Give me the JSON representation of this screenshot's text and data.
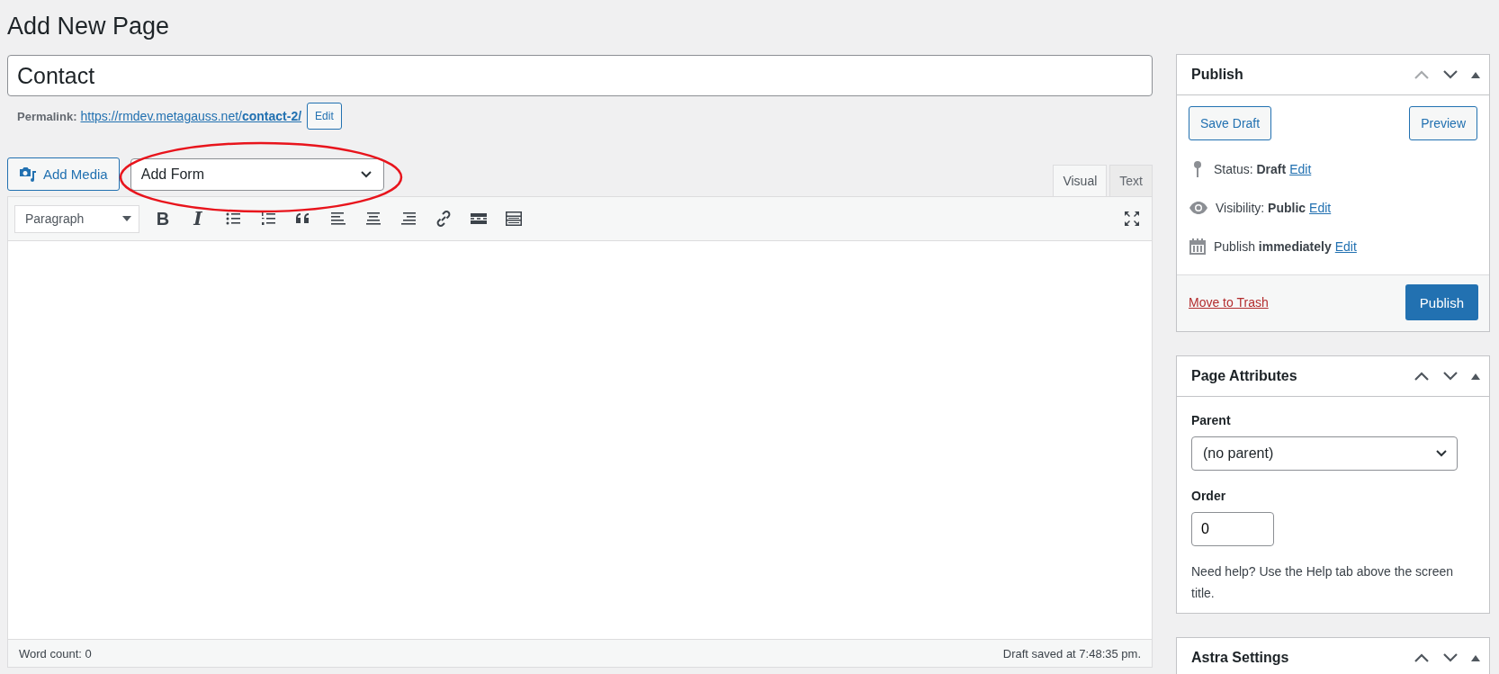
{
  "page_title": "Add New Page",
  "title_field": {
    "value": "Contact"
  },
  "permalink": {
    "label": "Permalink:",
    "url": "https://rmdev.metagauss.net/**contact-2/**",
    "edit": "Edit"
  },
  "media_button": "Add Media",
  "form_select": {
    "value": "Add Form",
    "circled": true
  },
  "editor_tabs": [
    {
      "label": "Visual",
      "selected": true
    },
    {
      "label": "Text",
      "selected": false
    }
  ],
  "format_select": {
    "value": "Paragraph"
  },
  "toolbar": [
    {
      "kind": "bold",
      "glyph": "B"
    },
    {
      "kind": "italic",
      "glyph": "I"
    },
    {
      "kind": "bullet-list"
    },
    {
      "kind": "numbered-list"
    },
    {
      "kind": "quote"
    },
    {
      "kind": "align-left"
    },
    {
      "kind": "align-center"
    },
    {
      "kind": "align-right"
    },
    {
      "kind": "link"
    },
    {
      "kind": "read-more"
    },
    {
      "kind": "toolbar-toggle"
    }
  ],
  "status_bar": {
    "word_count": "Word count: 0",
    "saved": "Draft saved at 7:48:35 pm."
  },
  "publish_box": {
    "title": "Publish",
    "can_move_up": false,
    "save_draft": "Save Draft",
    "preview": "Preview",
    "rows": [
      {
        "kind": "status",
        "text": "Status: **Draft**",
        "link": "Edit"
      },
      {
        "kind": "visibility",
        "text": "Visibility: **Public**",
        "link": "Edit"
      },
      {
        "kind": "schedule",
        "text": "Publish **immediately**",
        "link": "Edit"
      }
    ],
    "trash": "Move to Trash",
    "publish": "Publish"
  },
  "attributes_box": {
    "title": "Page Attributes",
    "can_move_up": true,
    "parent_label": "Parent",
    "parent_value": "(no parent)",
    "order_label": "Order",
    "order_value": "0",
    "help": "Need help? Use the Help tab above the screen title."
  },
  "astra_box": {
    "title": "Astra Settings",
    "can_move_up": true
  }
}
